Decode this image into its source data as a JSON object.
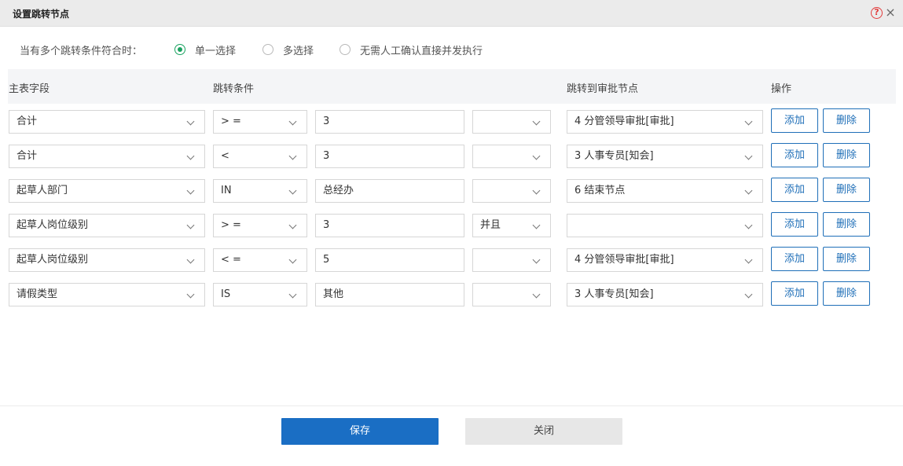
{
  "dialog": {
    "title": "设置跳转节点",
    "help_icon": "?",
    "close_icon": "×"
  },
  "mode": {
    "label": "当有多个跳转条件符合时：",
    "options": [
      {
        "label": "单一选择",
        "checked": true
      },
      {
        "label": "多选择",
        "checked": false
      },
      {
        "label": "无需人工确认直接并发执行",
        "checked": false
      }
    ]
  },
  "table": {
    "headers": {
      "field": "主表字段",
      "condition": "跳转条件",
      "target": "跳转到审批节点",
      "action": "操作"
    },
    "rows": [
      {
        "field": "合计",
        "op": "> =",
        "value": "3",
        "logic": "",
        "target": "4 分管领导审批[审批]"
      },
      {
        "field": "合计",
        "op": "<",
        "value": "3",
        "logic": "",
        "target": "3 人事专员[知会]"
      },
      {
        "field": "起草人部门",
        "op": "IN",
        "value": "总经办",
        "logic": "",
        "target": "6 结束节点"
      },
      {
        "field": "起草人岗位级别",
        "op": "> =",
        "value": "3",
        "logic": "并且",
        "target": ""
      },
      {
        "field": "起草人岗位级别",
        "op": "< =",
        "value": "5",
        "logic": "",
        "target": "4 分管领导审批[审批]"
      },
      {
        "field": "请假类型",
        "op": "IS",
        "value": "其他",
        "logic": "",
        "target": "3 人事专员[知会]"
      }
    ],
    "add_label": "添加",
    "delete_label": "删除"
  },
  "footer": {
    "save_label": "保存",
    "close_label": "关闭"
  },
  "colors": {
    "primary": "#1a6ec4",
    "radio_checked": "#1aa260",
    "help": "#e23b3b"
  }
}
